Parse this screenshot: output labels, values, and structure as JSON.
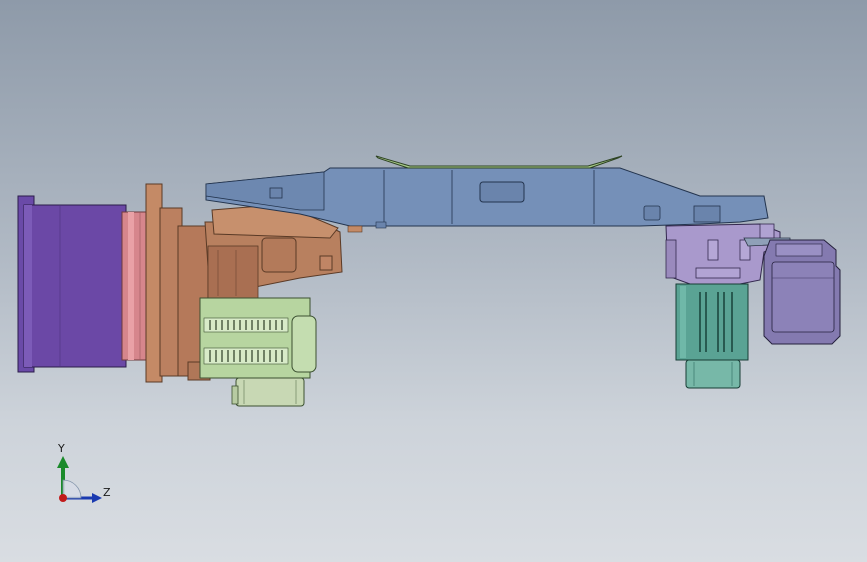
{
  "triad": {
    "y_label": "Y",
    "z_label": "Z"
  }
}
